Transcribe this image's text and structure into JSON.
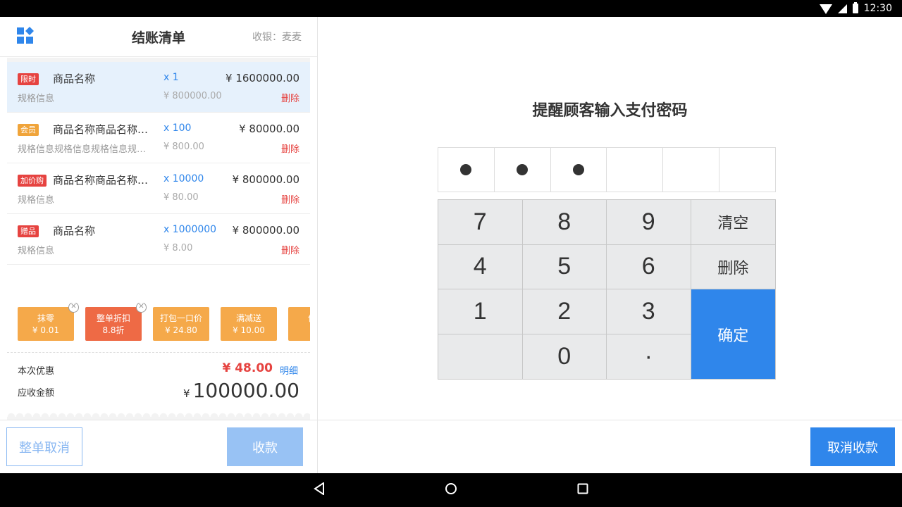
{
  "status_bar": {
    "time": "12:30"
  },
  "header": {
    "title": "结账清单",
    "cashier": "收银：麦麦"
  },
  "items": [
    {
      "tag": "限时",
      "tag_color": "#e64340",
      "name": "商品名称",
      "qty": "x 1",
      "price": "¥ 1600000.00",
      "spec": "规格信息",
      "unit_price": "¥ 800000.00",
      "delete": "删除",
      "selected": true
    },
    {
      "tag": "会员",
      "tag_color": "#f0a43a",
      "name": "商品名称商品名称商品名称",
      "qty": "x 100",
      "price": "¥ 80000.00",
      "spec": "规格信息规格信息规格信息规格信息",
      "unit_price": "¥ 800.00",
      "delete": "删除",
      "selected": false
    },
    {
      "tag": "加价购",
      "tag_color": "#e64340",
      "name": "商品名称商品名称商品名称",
      "qty": "x 10000",
      "price": "¥ 800000.00",
      "spec": "规格信息",
      "unit_price": "¥ 80.00",
      "delete": "删除",
      "selected": false
    },
    {
      "tag": "赠品",
      "tag_color": "#e64340",
      "name": "商品名称",
      "qty": "x 1000000",
      "price": "¥ 800000.00",
      "spec": "规格信息",
      "unit_price": "¥ 8.00",
      "delete": "删除",
      "selected": false
    }
  ],
  "promotions": [
    {
      "name": "抹零",
      "value": "¥ 0.01",
      "color": "#f5a94a",
      "closable": true
    },
    {
      "name": "整单折扣",
      "value": "8.8折",
      "color": "#ee6a45",
      "closable": true
    },
    {
      "name": "打包一口价",
      "value": "¥ 24.80",
      "color": "#f5a94a",
      "closable": false
    },
    {
      "name": "满减送",
      "value": "¥ 10.00",
      "color": "#f5a94a",
      "closable": false
    },
    {
      "name": "优惠",
      "value": "¥",
      "color": "#f5a94a",
      "closable": false
    }
  ],
  "summary": {
    "discount_label": "本次优惠",
    "discount_value": "¥ 48.00",
    "detail_link": "明细",
    "total_label": "应收金额",
    "total_currency": "¥",
    "total_value": "100000.00"
  },
  "left_footer": {
    "cancel_order": "整单取消",
    "collect": "收款"
  },
  "payment": {
    "prompt": "提醒顾客输入支付密码",
    "password_length": 6,
    "entered_digits": 3
  },
  "keypad": {
    "k7": "7",
    "k8": "8",
    "k9": "9",
    "clear": "清空",
    "k4": "4",
    "k5": "5",
    "k6": "6",
    "delete": "删除",
    "k1": "1",
    "k2": "2",
    "k3": "3",
    "confirm": "确定",
    "k0": "0",
    "dot": "·"
  },
  "right_footer": {
    "cancel_payment": "取消收款"
  }
}
